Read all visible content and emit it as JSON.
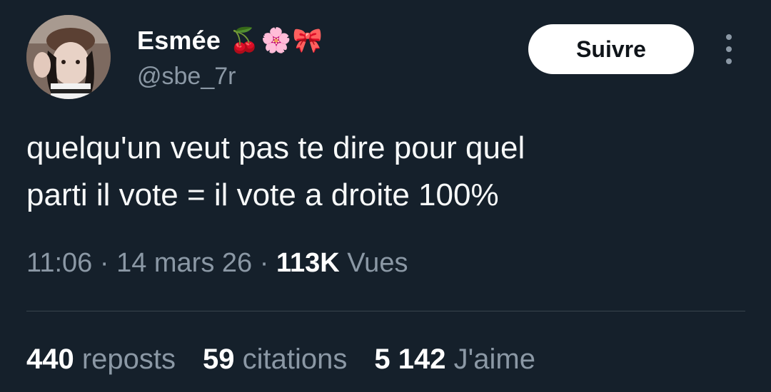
{
  "author": {
    "display_name": "Esmée",
    "name_emojis": [
      "🍒",
      "🌸",
      "🎀"
    ],
    "handle": "@sbe_7r",
    "avatar_icon": "profile-photo"
  },
  "actions": {
    "follow_label": "Suivre",
    "more_icon": "more-vertical-icon"
  },
  "tweet": {
    "line1": "quelqu'un veut pas te dire pour quel",
    "line2": "parti il vote = il vote a droite 100%"
  },
  "meta": {
    "time": "11:06",
    "separator": " · ",
    "date": "14 mars 26",
    "views_count": "113K",
    "views_label": " Vues"
  },
  "stats": {
    "reposts_count": "440",
    "reposts_label": " reposts",
    "quotes_count": "59",
    "quotes_label": " citations",
    "likes_count": "5 142",
    "likes_label": " J'aime"
  },
  "colors": {
    "background": "#15202b",
    "text_primary": "#ffffff",
    "text_secondary": "#8b98a5",
    "divider": "#38444d"
  }
}
